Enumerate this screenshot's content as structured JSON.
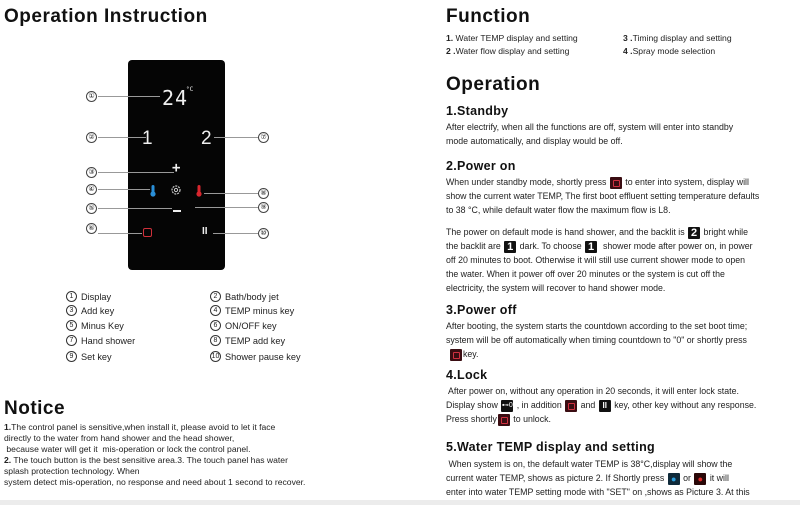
{
  "left": {
    "title": "Operation Instruction",
    "panel": {
      "temperature": "24",
      "temp_unit": "°C",
      "mode_1": "1",
      "mode_2": "2",
      "add_symbol": "+",
      "minus_symbol": "−",
      "pause_symbol": "II",
      "colors": {
        "cold": "#2a8fd8",
        "hot": "#d8262e",
        "power": "#d0303a",
        "panel_bg": "#050505"
      }
    },
    "callouts": [
      "①",
      "②",
      "③",
      "④",
      "⑤",
      "⑥",
      "⑦",
      "⑧",
      "⑨",
      "⑩"
    ],
    "legend": [
      {
        "num": "1",
        "label": "Display"
      },
      {
        "num": "2",
        "label": "Bath/body jet"
      },
      {
        "num": "3",
        "label": "Add key"
      },
      {
        "num": "4",
        "label": "TEMP minus key"
      },
      {
        "num": "5",
        "label": "Minus Key"
      },
      {
        "num": "6",
        "label": "ON/OFF key"
      },
      {
        "num": "7",
        "label": "Hand shower"
      },
      {
        "num": "8",
        "label": "TEMP add key"
      },
      {
        "num": "9",
        "label": "Set key"
      },
      {
        "num": "10",
        "label": "Shower pause key"
      }
    ],
    "notice": {
      "title": "Notice",
      "lines": [
        {
          "num": "1.",
          "text": "The control panel is sensitive,when install it, please avoid to let it face"
        },
        {
          "num": "",
          "text": "directly  to the water from hand shower and the head shower,"
        },
        {
          "num": "",
          "text": " because water will get it  mis-operation or lock the control panel."
        },
        {
          "num": "2.",
          "text": " The touch button is the best sensitive area.3. The touch panel has water"
        },
        {
          "num": "",
          "text": "splash protection technology. When"
        },
        {
          "num": "",
          "text": "system detect mis-operation, no response and need about 1 second to recover."
        }
      ]
    }
  },
  "right": {
    "function": {
      "title": "Function",
      "items": [
        {
          "num": "1.",
          "text": " Water TEMP display and setting"
        },
        {
          "num": "3 .",
          "text": "Timing display and setting"
        },
        {
          "num": "2 .",
          "text": "Water flow display and setting"
        },
        {
          "num": "4 .",
          "text": "Spray mode selection"
        }
      ]
    },
    "operation": {
      "title": "Operation",
      "standby": {
        "title": "1.Standby",
        "l1": "After electrify, when all the functions are off, system will enter into standby",
        "l2": "mode automatically, and display would be off."
      },
      "power_on": {
        "title": "2.Power on",
        "p1a": "When under standby mode, shortly press ",
        "p1b": " to enter into system, display will",
        "p1c": "show the current water TEMP, The first boot effluent setting temperature defaults",
        "p1d": "to 38 °C,  while default water flow the maximum flow is L8.",
        "p2a": "The power on default mode is hand shower, and the backlit is ",
        "p2_icon_2": "2",
        "p2b": " bright while",
        "p2c": "the backlit are ",
        "p2_icon_1": "1",
        "p2d": " dark. To choose ",
        "p2e": "  shower mode after power on, in power",
        "p2f": "off 20 minutes to boot. Otherwise it will still use current shower mode to open",
        "p2g": "the water. When it power off over 20 minutes or the system is cut off the",
        "p2h": "electricity, the system will recover to hand shower mode."
      },
      "power_off": {
        "title": "3.Power off",
        "l1": "After booting, the system starts the countdown according to the set boot time;",
        "l2": "system will be off automatically when timing countdown to \"0\" or shortly press",
        "l3": "key."
      },
      "lock": {
        "title": "4.Lock",
        "l1": " After power on, without any operation in 20 seconds, it will enter lock state.",
        "l2a": "Display show ",
        "lock_glyph": "⊷0",
        "l2b": " , in addition ",
        "l2c": " and ",
        "pause_glyph": "II",
        "l2d": " key, other key without any response.",
        "l3a": "Press shortly",
        "l3b": " to unlock."
      },
      "water_temp": {
        "title": "5.Water TEMP display and setting",
        "l1": " When system is on, the default water TEMP is 38°C,display will show the",
        "l2a": "current water TEMP, shows as picture 2.  If Shortly press ",
        "l2b": " or ",
        "l2c": " it will",
        "l3": "enter into water TEMP setting mode with \"SET\" on ,shows as Picture 3. At this"
      }
    }
  }
}
